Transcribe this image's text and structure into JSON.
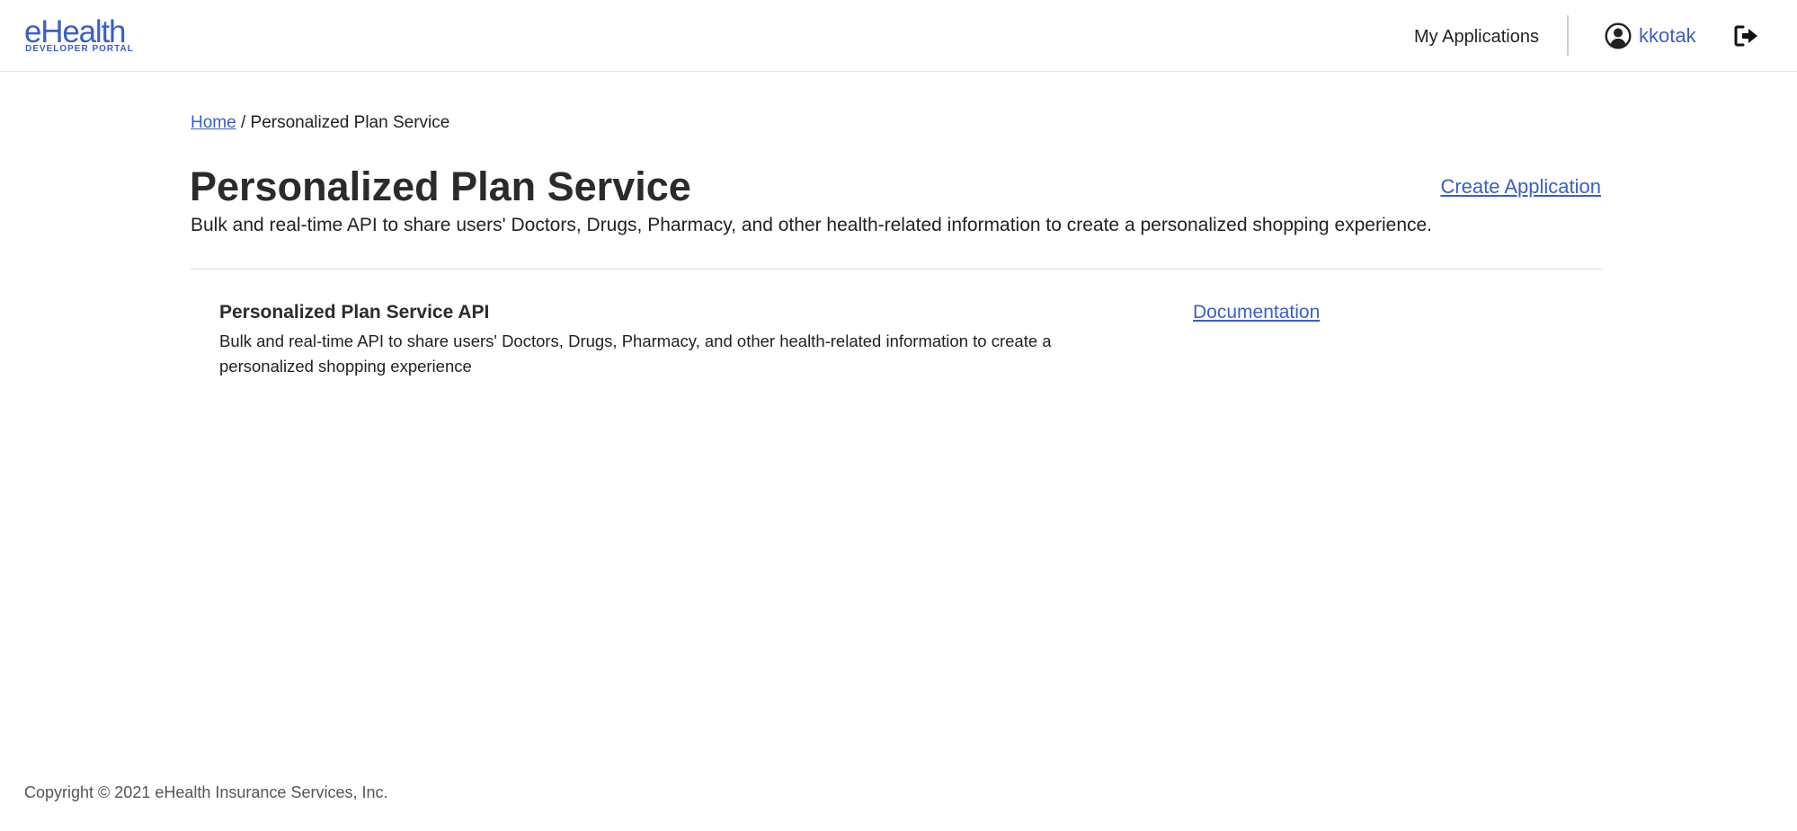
{
  "header": {
    "logo": {
      "main": "eHealth",
      "sub": "DEVELOPER PORTAL"
    },
    "nav": {
      "my_applications": "My Applications"
    },
    "user": {
      "name": "kkotak",
      "icon": "user-circle-icon"
    },
    "logout_icon": "logout-icon"
  },
  "breadcrumb": {
    "home": "Home",
    "separator": " / ",
    "current": "Personalized Plan Service"
  },
  "page": {
    "title": "Personalized Plan Service",
    "create_application": "Create Application",
    "description": "Bulk and real-time API to share users' Doctors, Drugs, Pharmacy, and other health-related information to create a personalized shopping experience."
  },
  "apis": [
    {
      "name": "Personalized Plan Service API",
      "description": "Bulk and real-time API to share users' Doctors, Drugs, Pharmacy, and other health-related information to create a personalized shopping experience",
      "documentation_label": "Documentation"
    }
  ],
  "footer": {
    "copyright": "Copyright © 2021 eHealth Insurance Services, Inc."
  },
  "colors": {
    "brand": "#3a5fc4",
    "text": "#222222",
    "divider": "#d9d9d9"
  }
}
